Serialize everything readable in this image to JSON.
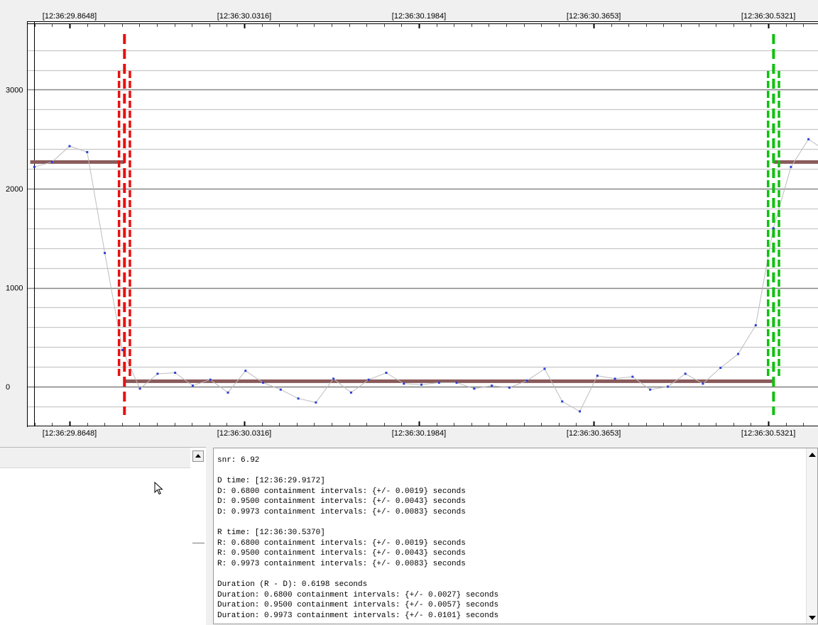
{
  "plot": {
    "time_ticks": [
      "[12:36:29.8648]",
      "[12:36:30.0316]",
      "[12:36:30.1984]",
      "[12:36:30.3653]",
      "[12:36:30.5321]"
    ],
    "y_ticks": [
      "3000",
      "2000",
      "1000",
      "0"
    ]
  },
  "chart_data": {
    "type": "line",
    "ylim": [
      -400,
      3650
    ],
    "x_ticks_seconds": [
      29.8648,
      30.0316,
      30.1984,
      30.3653,
      30.5321
    ],
    "samples": {
      "x": [
        29.8312,
        29.848,
        29.8648,
        29.8816,
        29.8984,
        29.9152,
        29.932,
        29.9488,
        29.9656,
        29.9824,
        29.9992,
        30.016,
        30.0328,
        30.0496,
        30.0664,
        30.0832,
        30.1,
        30.1168,
        30.1336,
        30.1504,
        30.1672,
        30.184,
        30.2008,
        30.2176,
        30.2344,
        30.2512,
        30.268,
        30.2848,
        30.3016,
        30.3184,
        30.3352,
        30.352,
        30.3688,
        30.3856,
        30.4024,
        30.4192,
        30.436,
        30.4528,
        30.4696,
        30.4864,
        30.5032,
        30.52,
        30.5368,
        30.5536,
        30.5704,
        30.5872
      ],
      "y": [
        2220,
        2270,
        2430,
        2370,
        1350,
        370,
        -20,
        130,
        140,
        10,
        70,
        -60,
        160,
        40,
        -30,
        -120,
        -160,
        80,
        -60,
        70,
        140,
        30,
        20,
        40,
        40,
        -20,
        10,
        -10,
        60,
        180,
        -150,
        -250,
        110,
        80,
        100,
        -30,
        0,
        130,
        30,
        190,
        330,
        620,
        1600,
        2220,
        2500,
        2380
      ]
    },
    "plateaus": [
      {
        "x_start": 29.8272,
        "x_end": 29.9172,
        "y": 2270
      },
      {
        "x_start": 29.9172,
        "x_end": 30.537,
        "y": 55
      },
      {
        "x_start": 30.537,
        "x_end": 30.592,
        "y": 2270
      }
    ],
    "markers": [
      {
        "label": "D",
        "time": 29.9172,
        "color": "#e81010",
        "intervals": [
          0.0019,
          0.0043,
          0.0083
        ]
      },
      {
        "label": "R",
        "time": 30.537,
        "color": "#10c010",
        "intervals": [
          0.0019,
          0.0043,
          0.0083
        ]
      }
    ],
    "colors": {
      "samples": "#2a3fd8",
      "trace": "#bdbdbd",
      "plateau": "#8a5a5a",
      "grid": "#c8c8c8",
      "zero_line": "#808080"
    }
  },
  "results_text": "snr: 6.92\n\nD time: [12:36:29.9172]\nD: 0.6800 containment intervals: {+/- 0.0019} seconds\nD: 0.9500 containment intervals: {+/- 0.0043} seconds\nD: 0.9973 containment intervals: {+/- 0.0083} seconds\n\nR time: [12:36:30.5370]\nR: 0.6800 containment intervals: {+/- 0.0019} seconds\nR: 0.9500 containment intervals: {+/- 0.0043} seconds\nR: 0.9973 containment intervals: {+/- 0.0083} seconds\n\nDuration (R - D): 0.6198 seconds\nDuration: 0.6800 containment intervals: {+/- 0.0027} seconds\nDuration: 0.9500 containment intervals: {+/- 0.0057} seconds\nDuration: 0.9973 containment intervals: {+/- 0.0101} seconds"
}
